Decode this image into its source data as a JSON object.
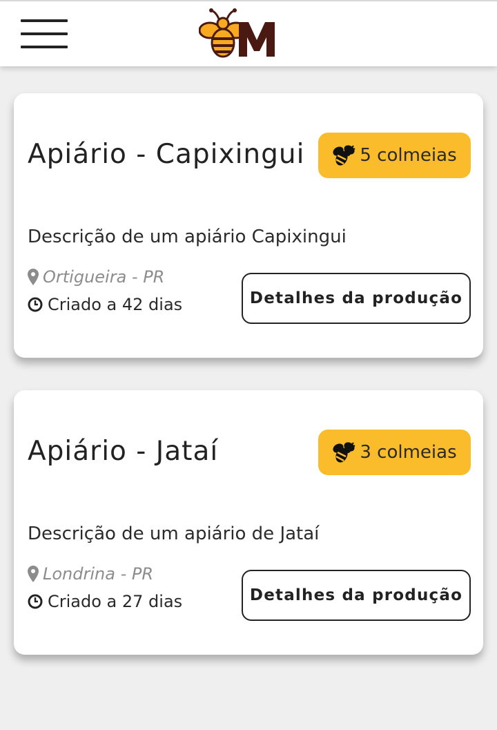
{
  "header": {
    "menu_icon": "hamburger-menu-icon",
    "logo_text": "M"
  },
  "apiaries": [
    {
      "title": "Apiário - Capixingui",
      "hives_label": "5 colmeias",
      "description": "Descrição de um apiário Capixingui",
      "location": "Ortigueira - PR",
      "created": "Criado a 42 dias",
      "details_label": "Detalhes da produção"
    },
    {
      "title": "Apiário - Jataí",
      "hives_label": "3 colmeias",
      "description": "Descrição de um apiário de Jataí",
      "location": "Londrina - PR",
      "created": "Criado a 27 dias",
      "details_label": "Detalhes da produção"
    }
  ],
  "colors": {
    "accent": "#fbbc2c",
    "logo_brown": "#4a1a12",
    "background": "#efefef"
  }
}
